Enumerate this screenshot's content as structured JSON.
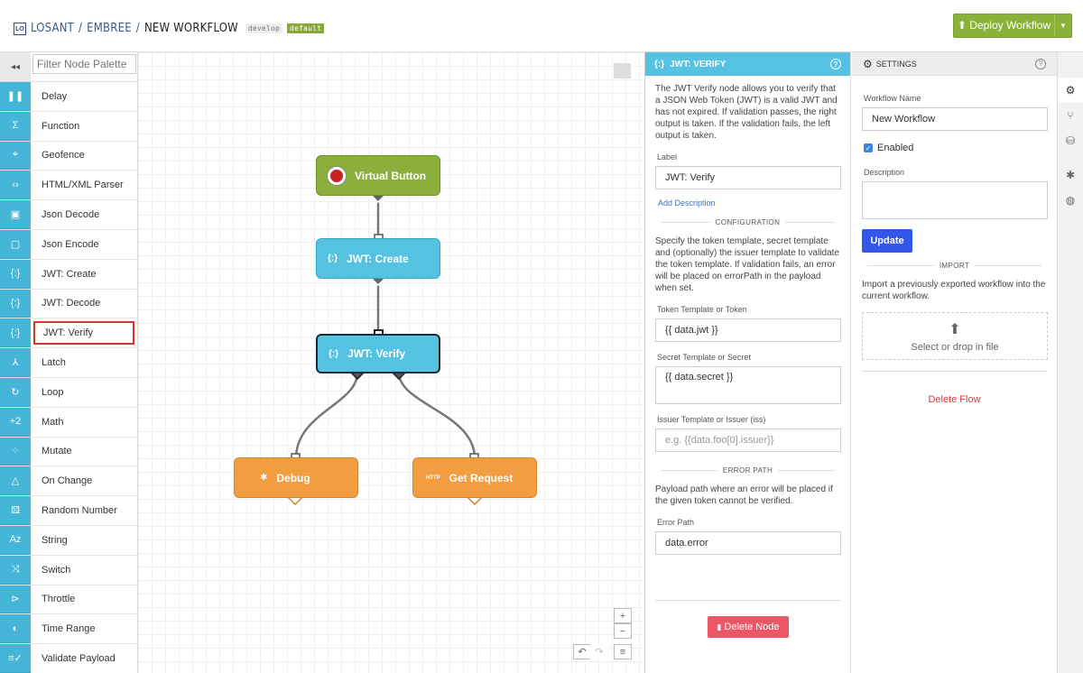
{
  "header": {
    "logo": "LO",
    "breadcrumb": [
      "LOSANT",
      "EMBREE",
      "NEW WORKFLOW"
    ],
    "separator": "/",
    "version_tag": "develop",
    "default_tag": "default",
    "deploy_label": "Deploy Workflow",
    "deploy_icon": "⬆",
    "caret": "▼"
  },
  "palette": {
    "collapse_icon": "◂◂",
    "filter_placeholder": "Filter Node Palette",
    "items": [
      {
        "label": "Delay",
        "icon": "❚❚"
      },
      {
        "label": "Function",
        "icon": "Σ"
      },
      {
        "label": "Geofence",
        "icon": "⌖"
      },
      {
        "label": "HTML/XML Parser",
        "icon": "‹›"
      },
      {
        "label": "Json Decode",
        "icon": "▣"
      },
      {
        "label": "Json Encode",
        "icon": "▢"
      },
      {
        "label": "JWT: Create",
        "icon": "{:}"
      },
      {
        "label": "JWT: Decode",
        "icon": "{:}"
      },
      {
        "label": "JWT: Verify",
        "icon": "{:}"
      },
      {
        "label": "Latch",
        "icon": "⅄"
      },
      {
        "label": "Loop",
        "icon": "↻"
      },
      {
        "label": "Math",
        "icon": "+2"
      },
      {
        "label": "Mutate",
        "icon": "⁘"
      },
      {
        "label": "On Change",
        "icon": "△"
      },
      {
        "label": "Random Number",
        "icon": "⚄"
      },
      {
        "label": "String",
        "icon": "Az"
      },
      {
        "label": "Switch",
        "icon": "⤨"
      },
      {
        "label": "Throttle",
        "icon": "⊳"
      },
      {
        "label": "Time Range",
        "icon": "◐"
      },
      {
        "label": "Validate Payload",
        "icon": "≡✓"
      }
    ],
    "selected": "JWT: Verify"
  },
  "canvas": {
    "nodes": {
      "virtual_button": "Virtual Button",
      "jwt_create": "JWT: Create",
      "jwt_verify": "JWT: Verify",
      "debug": "Debug",
      "get_request": "Get Request"
    },
    "icons": {
      "jwt": "{:}",
      "debug": "✱",
      "http": "HTTP"
    },
    "controls": {
      "zoom_in": "+",
      "zoom_out": "−",
      "undo": "↶",
      "redo": "↷",
      "menu": "≡"
    }
  },
  "node_config": {
    "title": "JWT: VERIFY",
    "help": "?",
    "description": "The JWT Verify node allows you to verify that a JSON Web Token (JWT) is a valid JWT and has not expired. If validation passes, the right output is taken. If the validation fails, the left output is taken.",
    "label_field": {
      "label": "Label",
      "value": "JWT: Verify"
    },
    "add_description": "Add Description",
    "configuration_header": "CONFIGURATION",
    "configuration_text": "Specify the token template, secret template and (optionally) the issuer template to validate the token template. If validation fails, an error will be placed on errorPath in the payload when set.",
    "token_field": {
      "label": "Token Template or Token",
      "value": "{{ data.jwt }}"
    },
    "secret_field": {
      "label": "Secret Template or Secret",
      "value": "{{ data.secret }}"
    },
    "issuer_field": {
      "label": "Issuer Template or Issuer (iss)",
      "placeholder": "e.g. {{data.foo[0].issuer}}"
    },
    "error_header": "ERROR PATH",
    "error_text": "Payload path where an error will be placed if the given token cannot be verified.",
    "error_field": {
      "label": "Error Path",
      "value": "data.error"
    },
    "delete_label": "Delete Node",
    "delete_icon": "▮"
  },
  "settings": {
    "title": "SETTINGS",
    "gear_icon": "⚙",
    "help": "?",
    "name_label": "Workflow Name",
    "name_value": "New Workflow",
    "enabled_label": "Enabled",
    "enabled": true,
    "description_label": "Description",
    "update_label": "Update",
    "import_header": "IMPORT",
    "import_text": "Import a previously exported workflow into the current workflow.",
    "drop_label": "Select or drop in file",
    "drop_icon": "⬆",
    "delete_flow": "Delete Flow"
  },
  "rail": {
    "items": [
      {
        "icon": "⚙",
        "name": "settings-icon"
      },
      {
        "icon": "⑂",
        "name": "branch-icon"
      },
      {
        "icon": "⛁",
        "name": "storage-icon"
      },
      {
        "icon": "✱",
        "name": "debug-icon"
      },
      {
        "icon": "◍",
        "name": "globe-icon"
      }
    ]
  },
  "colors": {
    "accent_blue": "#55c2e2",
    "trigger_green": "#8ab03b",
    "output_orange": "#f29d40",
    "danger": "#ee5566",
    "update_blue": "#3357e8"
  }
}
